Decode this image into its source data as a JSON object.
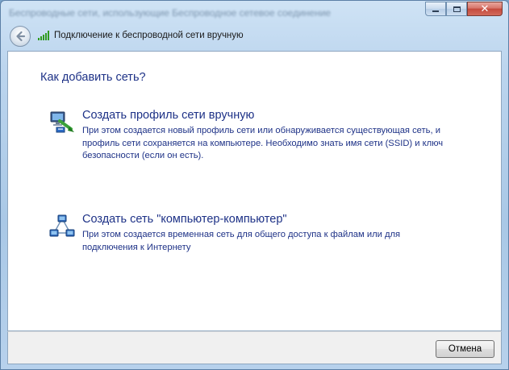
{
  "window": {
    "background_title": "Беспроводные сети, использующие Беспроводное сетевое соединение",
    "min_icon": "minimize-icon",
    "max_icon": "maximize-icon",
    "close_icon": "close-icon",
    "close_glyph": "✕"
  },
  "nav": {
    "back_icon": "back-arrow-icon",
    "network_icon": "wireless-signal-icon",
    "title": "Подключение к беспроводной сети вручную"
  },
  "main": {
    "heading": "Как добавить сеть?",
    "options": [
      {
        "icon": "network-profile-icon",
        "title": "Создать профиль сети вручную",
        "description": "При этом создается новый профиль сети или обнаруживается существующая сеть, и профиль сети сохраняется на компьютере. Необходимо знать имя сети (SSID) и ключ безопасности (если он есть)."
      },
      {
        "icon": "ad-hoc-network-icon",
        "title": "Создать сеть \"компьютер-компьютер\"",
        "description": "При этом создается временная сеть для общего доступа к файлам или для подключения к Интернету"
      }
    ]
  },
  "footer": {
    "cancel_label": "Отмена"
  },
  "colors": {
    "link_text": "#1e3287",
    "signal_green": "#2f9a1e",
    "close_red": "#c44a3c"
  }
}
